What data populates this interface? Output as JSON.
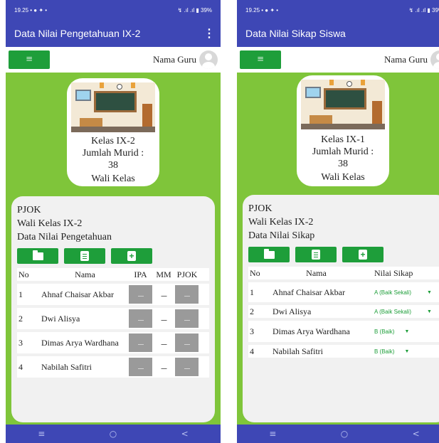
{
  "screens": [
    {
      "status_time": "19.25",
      "status_icons": "• ● ✦ •",
      "status_right": "↯ .ıl .ıl ▮ 39%",
      "title": "Data Nilai Pengetahuan IX-2",
      "menu_icon": "≡",
      "kebab": "⋮",
      "guru_label": "Nama Guru",
      "card": {
        "kelas": "Kelas IX-2",
        "jumlah_label": "Jumlah Murid :",
        "jumlah": "38",
        "wali": "Wali Kelas"
      },
      "panel": {
        "subject": "PJOK",
        "wali": "Wali Kelas IX-2",
        "data": "Data Nilai Pengetahuan"
      },
      "table": {
        "headers": {
          "no": "No",
          "nama": "Nama",
          "ipa": "IPA",
          "mm": "MM",
          "pjok": "PJOK"
        },
        "rows": [
          {
            "no": "1",
            "nama": "Ahnaf Chaisar Akbar"
          },
          {
            "no": "2",
            "nama": "Dwi Alisya"
          },
          {
            "no": "3",
            "nama": "Dimas Arya Wardhana"
          },
          {
            "no": "4",
            "nama": "Nabilah Safitri"
          }
        ],
        "cell_dots": "........"
      },
      "nav": {
        "recent": "≡",
        "home": "○",
        "back": "<"
      }
    },
    {
      "status_time": "19.25",
      "status_icons": "• ● ✦ •",
      "status_right": "↯ .ıl .ıl ▮ 39%",
      "title": "Data Nilai Sikap Siswa",
      "menu_icon": "≡",
      "kebab": "⋮",
      "guru_label": "Nama Guru",
      "card": {
        "kelas": "Kelas IX-1",
        "jumlah_label": "Jumlah Murid :",
        "jumlah": "38",
        "wali": "Wali Kelas"
      },
      "panel": {
        "subject": "PJOK",
        "wali": "Wali Kelas IX-2",
        "data": "Data Nilai Sikap"
      },
      "table": {
        "headers": {
          "no": "No",
          "nama": "Nama",
          "nilai": "Nilai Sikap"
        },
        "rows": [
          {
            "no": "1",
            "nama": "Ahnaf Chaisar Akbar",
            "nilai": "A (Baik Sekali)"
          },
          {
            "no": "2",
            "nama": "Dwi Alisya",
            "nilai": "A (Baik Sekali)"
          },
          {
            "no": "3",
            "nama": "Dimas Arya Wardhana",
            "nilai": "B (Baik)"
          },
          {
            "no": "4",
            "nama": "Nabilah Safitri",
            "nilai": "B (Baik)"
          }
        ],
        "caret": "▼"
      },
      "nav": {
        "recent": "≡",
        "home": "○",
        "back": "<"
      }
    }
  ]
}
